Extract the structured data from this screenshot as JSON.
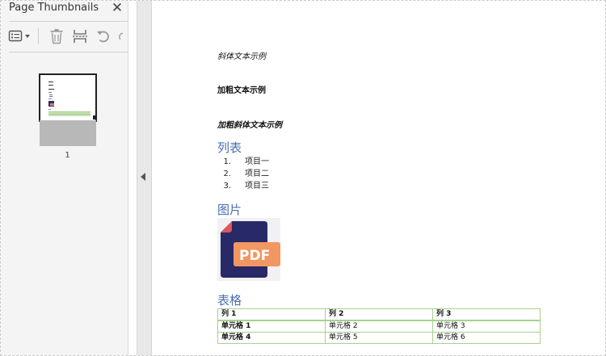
{
  "panel": {
    "title": "Page Thumbnails",
    "close_glyph": "✕",
    "toolbar": {
      "options_icon": "list-options-icon",
      "delete_icon": "trash-icon",
      "extract_icon": "extract-page-icon",
      "undo_icon": "rotate-ccw-icon",
      "redo_icon": "rotate-cw-icon"
    },
    "thumbnail": {
      "page_number": "1"
    }
  },
  "document": {
    "italic_text": "斜体文本示例",
    "bold_text": "加粗文本示例",
    "bold_italic_text": "加粗斜体文本示例",
    "list_heading": "列表",
    "list_items": [
      {
        "num": "1.",
        "text": "项目一"
      },
      {
        "num": "2.",
        "text": "项目二"
      },
      {
        "num": "3.",
        "text": "项目三"
      }
    ],
    "image_heading": "图片",
    "image_label": "PDF",
    "table_heading": "表格",
    "table": {
      "header": [
        "列 1",
        "列 2",
        "列 3"
      ],
      "rows": [
        [
          "单元格 1",
          "单元格 2",
          "单元格 3"
        ],
        [
          "单元格 4",
          "单元格 5",
          "单元格 6"
        ]
      ]
    }
  },
  "colors": {
    "heading_blue": "#4a6fb0",
    "table_border": "#a9d18e"
  }
}
